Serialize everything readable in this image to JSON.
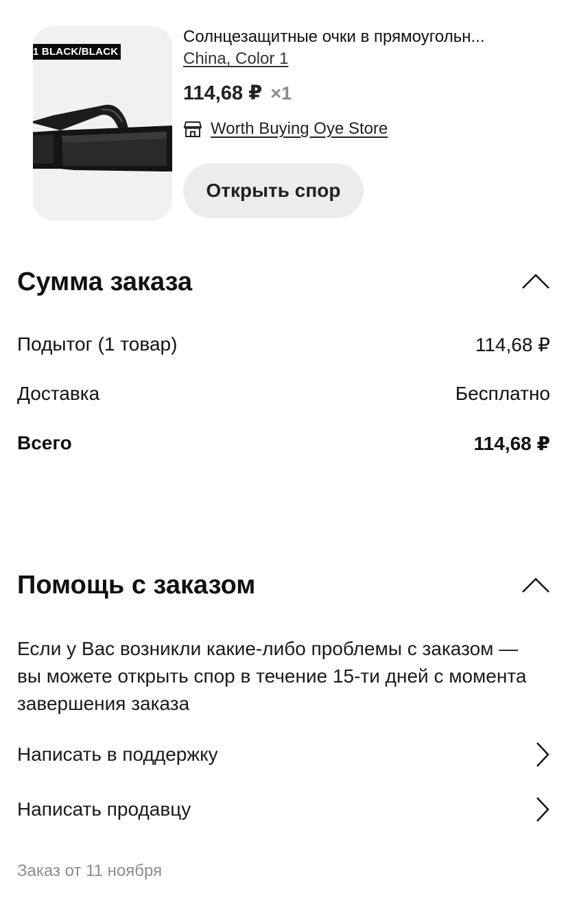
{
  "product": {
    "image_label": "1 BLACK/BLACK",
    "title": "Солнцезащитные очки в прямоугольн...",
    "variant": "China, Color 1",
    "price": "114,68 ₽",
    "quantity": "×1",
    "store_name": "Worth Buying Oye Store",
    "dispute_button": "Открыть спор"
  },
  "order_summary": {
    "title": "Сумма заказа",
    "rows": [
      {
        "label": "Подытог (1 товар)",
        "value": "114,68 ₽"
      },
      {
        "label": "Доставка",
        "value": "Бесплатно"
      },
      {
        "label": "Всего",
        "value": "114,68 ₽"
      }
    ]
  },
  "order_help": {
    "title": "Помощь с заказом",
    "description": "Если у Вас возникли какие-либо проблемы с заказом — вы можете открыть спор в течение 15-ти дней с момента завершения заказа",
    "links": [
      {
        "label": "Написать в поддержку"
      },
      {
        "label": "Написать продавцу"
      }
    ]
  },
  "order_date": "Заказ от 11 ноября",
  "icons": {
    "store": "store-icon",
    "collapse": "chevron-up-icon",
    "navigate": "chevron-right-icon"
  }
}
